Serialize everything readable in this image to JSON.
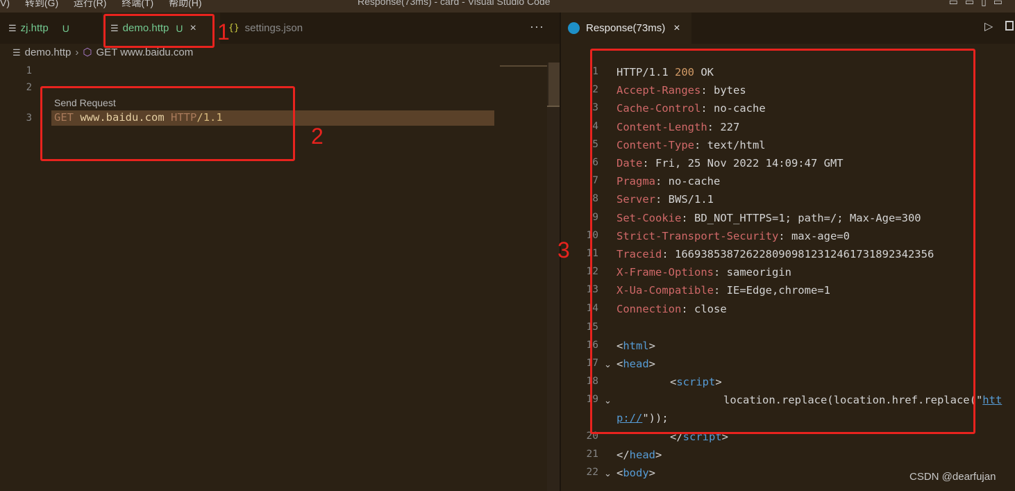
{
  "titlebar": {
    "menu": [
      "V)",
      "转到(G)",
      "运行(R)",
      "终端(T)",
      "帮助(H)"
    ],
    "title": "Response(73ms) - card - Visual Studio Code"
  },
  "left_tabs": [
    {
      "label": "zj.http",
      "status": "U"
    },
    {
      "label": "demo.http",
      "status": "U",
      "close": "×"
    },
    {
      "label": "settings.json"
    }
  ],
  "more_actions": "···",
  "breadcrumb": {
    "file": "demo.http",
    "symbol": "GET www.baidu.com"
  },
  "editor": {
    "line_numbers": [
      "1",
      "2",
      "3"
    ],
    "codelens": "Send Request",
    "request": {
      "method": "GET",
      "url": "www.baidu.com",
      "proto": "HTTP",
      "slash": "/",
      "version": "1.1"
    }
  },
  "right_tab": {
    "label": "Response(73ms)",
    "close": "×"
  },
  "response_lines": [
    {
      "n": "1",
      "name": "HTTP/1.1 ",
      "sep": "",
      "value": "",
      "status_code": "200",
      "status_text": " OK"
    },
    {
      "n": "2",
      "name": "Accept-Ranges",
      "sep": ": ",
      "value": "bytes"
    },
    {
      "n": "3",
      "name": "Cache-Control",
      "sep": ": ",
      "value": "no-cache"
    },
    {
      "n": "4",
      "name": "Content-Length",
      "sep": ": ",
      "value": "227"
    },
    {
      "n": "5",
      "name": "Content-Type",
      "sep": ": ",
      "value": "text/html"
    },
    {
      "n": "6",
      "name": "Date",
      "sep": ": ",
      "value": "Fri, 25 Nov 2022 14:09:47 GMT"
    },
    {
      "n": "7",
      "name": "Pragma",
      "sep": ": ",
      "value": "no-cache"
    },
    {
      "n": "8",
      "name": "Server",
      "sep": ": ",
      "value": "BWS/1.1"
    },
    {
      "n": "9",
      "name": "Set-Cookie",
      "sep": ": ",
      "value": "BD_NOT_HTTPS=1; path=/; Max-Age=300"
    },
    {
      "n": "10",
      "name": "Strict-Transport-Security",
      "sep": ": ",
      "value": "max-age=0"
    },
    {
      "n": "11",
      "name": "Traceid",
      "sep": ": ",
      "value": "1669385387262280909812312461731892342356"
    },
    {
      "n": "12",
      "name": "X-Frame-Options",
      "sep": ": ",
      "value": "sameorigin"
    },
    {
      "n": "13",
      "name": "X-Ua-Compatible",
      "sep": ": ",
      "value": "IE=Edge,chrome=1"
    },
    {
      "n": "14",
      "name": "Connection",
      "sep": ": ",
      "value": "close"
    }
  ],
  "html_lines": {
    "l15": "15",
    "l16": {
      "n": "16",
      "open": "<",
      "tag": "html",
      "close": ">"
    },
    "l17": {
      "n": "17",
      "open": "<",
      "tag": "head",
      "close": ">"
    },
    "l18": {
      "n": "18",
      "open": "<",
      "tag": "script",
      "close": ">"
    },
    "l19": {
      "n": "19",
      "code": "location.replace(location.href.replace(\"",
      "link": "htt"
    },
    "l19b": {
      "link": "p://",
      "rest": "\"));"
    },
    "l20": {
      "n": "20",
      "open": "</",
      "tag": "script",
      "close": ">"
    },
    "l21": {
      "n": "21",
      "open": "</",
      "tag": "head",
      "close": ">"
    },
    "l22": {
      "n": "22",
      "open": "<",
      "tag": "body",
      "close": ">"
    }
  },
  "annotations": [
    "1",
    "2",
    "3"
  ],
  "watermark": "CSDN @dearfujan"
}
